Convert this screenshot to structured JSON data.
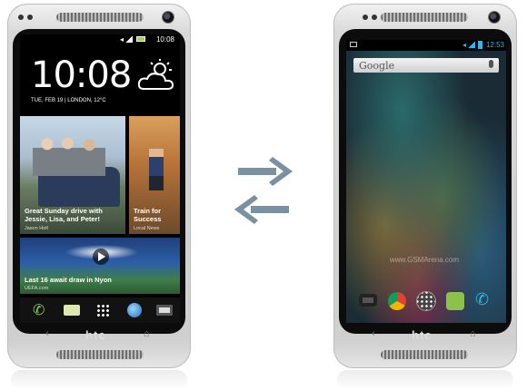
{
  "left_phone": {
    "brand": "htc",
    "status_time": "10:08",
    "clock_time": "10:08",
    "date_line": "TUE, FEB 19 | LONDON, 12°C",
    "tiles": [
      {
        "caption": "Great Sunday drive with Jessie, Lisa, and Peter!",
        "source": "Jason Holt"
      },
      {
        "caption": "Train for Success",
        "source": "Local News"
      },
      {
        "caption": "Last 16 await draw in Nyon",
        "source": "UEFA.com"
      }
    ],
    "dock_icons": [
      "phone-icon",
      "messages-icon",
      "apps-grid-icon",
      "browser-icon",
      "camera-icon"
    ],
    "nav_icons": [
      "back-icon",
      "home-icon"
    ]
  },
  "arrows": {
    "top_direction": "right",
    "bottom_direction": "left",
    "color": "#7a90a3"
  },
  "right_phone": {
    "brand": "htc",
    "status_time": "12:53",
    "search_label": "Google",
    "watermark": "www.GSMArena.com",
    "dock_icons": [
      "camera-icon",
      "chrome-icon",
      "app-drawer-icon",
      "messaging-icon",
      "phone-icon"
    ],
    "nav_icons": [
      "back-icon",
      "home-icon"
    ]
  }
}
